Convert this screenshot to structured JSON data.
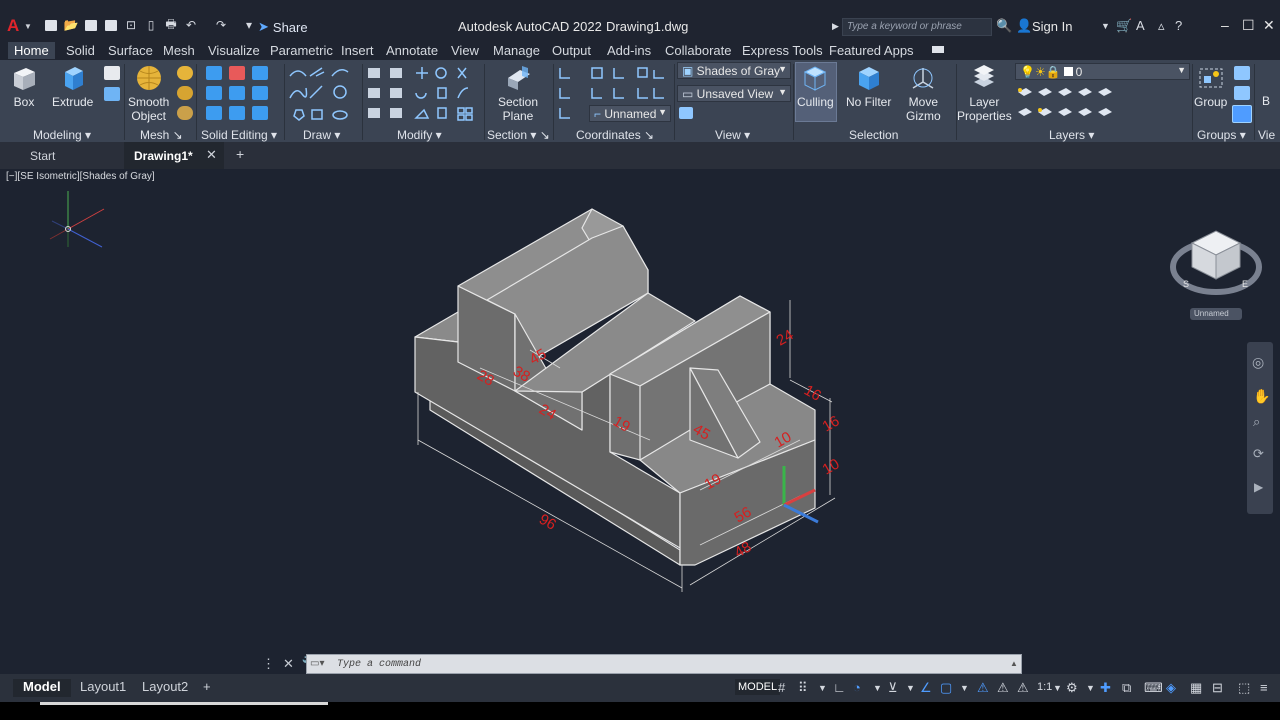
{
  "app": {
    "logo": "A",
    "title": "Autodesk AutoCAD 2022",
    "file": "Drawing1.dwg",
    "share_label": "Share",
    "search_placeholder": "Type a keyword or phrase",
    "sign_in": "Sign In"
  },
  "ribbon_tabs": [
    "Home",
    "Solid",
    "Surface",
    "Mesh",
    "Visualize",
    "Parametric",
    "Insert",
    "Annotate",
    "View",
    "Manage",
    "Output",
    "Add-ins",
    "Collaborate",
    "Express Tools",
    "Featured Apps"
  ],
  "ribbon": {
    "box_label": "Box",
    "extrude_label": "Extrude",
    "smooth_label": "Smooth\nObject",
    "section_label": "Section\nPlane",
    "culling_label": "Culling",
    "nofilter_label": "No Filter",
    "movegizmo_label": "Move\nGizmo",
    "layerprops_label": "Layer\nProperties",
    "group_label": "Group",
    "visual_style": "Shades of Gray",
    "named_view": "Unsaved View",
    "ucs_name": "Unnamed",
    "layer_name": "0",
    "panels": [
      "Modeling",
      "Mesh",
      "Solid Editing",
      "Draw",
      "Modify",
      "Section",
      "Coordinates",
      "View",
      "Selection",
      "Layers",
      "Groups",
      "Vie"
    ]
  },
  "doc_tabs": [
    "Start",
    "Drawing1*"
  ],
  "viewport": {
    "label": "[−][SE Isometric][Shades of Gray]",
    "ucs_badge": "Unnamed",
    "dimensions": [
      "96",
      "48",
      "24",
      "16",
      "16",
      "10",
      "10",
      "19",
      "45",
      "28",
      "56",
      "19",
      "45",
      "24",
      "38"
    ]
  },
  "command": {
    "placeholder": "Type a command"
  },
  "layout_tabs": [
    "Model",
    "Layout1",
    "Layout2"
  ],
  "status": {
    "model": "MODEL",
    "scale": "1:1"
  }
}
